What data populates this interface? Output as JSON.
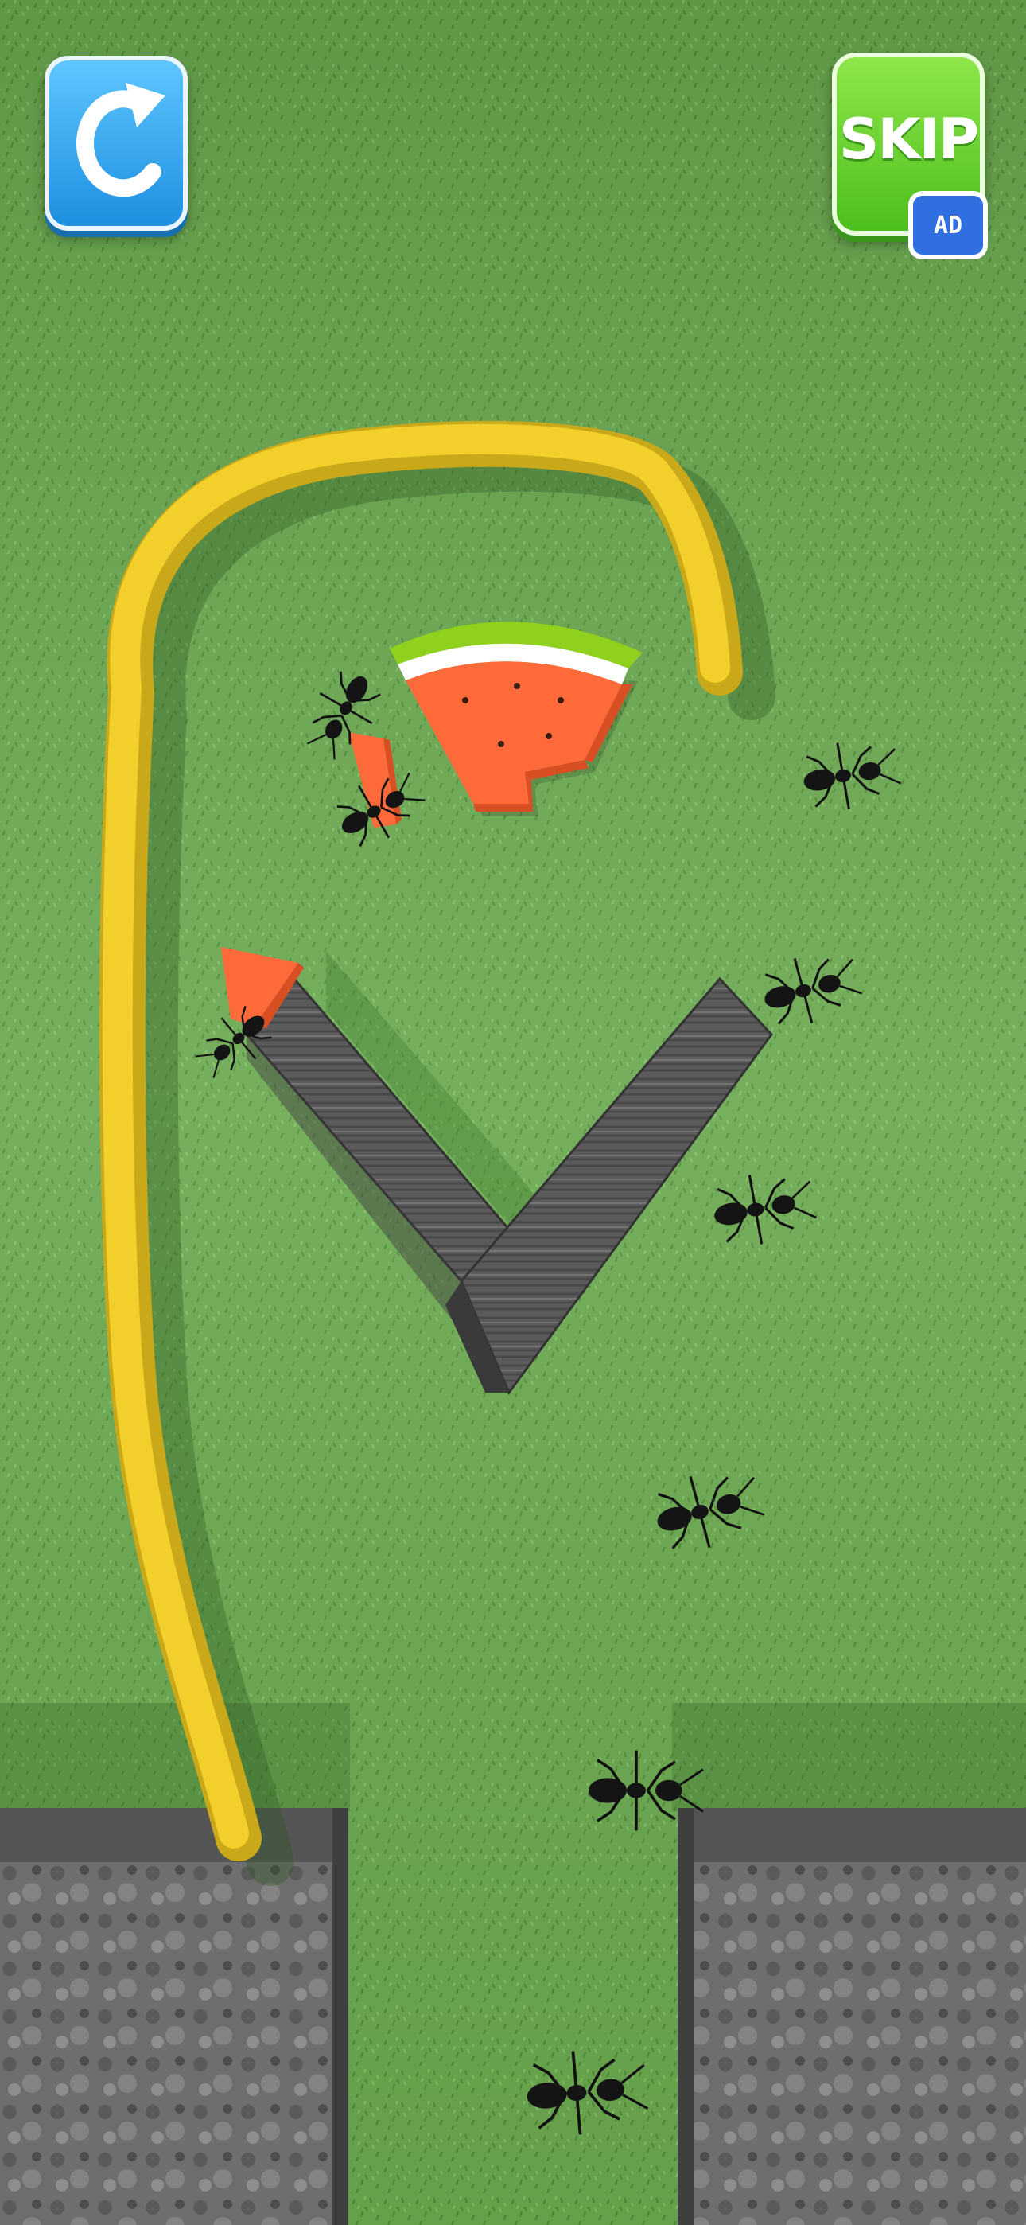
{
  "hud": {
    "restart_icon": "restart-arrow-icon",
    "skip_label": "SKIP",
    "ad_badge_label": "AD",
    "ad_icon": "video-ad-icon"
  },
  "scene": {
    "grass_color": "#6aa84f",
    "drawn_line_color": "#f2cf2a",
    "wood_color": "#5e5e5e",
    "watermelon_flesh_color": "#ff6a3a",
    "watermelon_rind_color": "#8fd11c",
    "ant_count": 9,
    "carried_food_pieces": 2
  }
}
